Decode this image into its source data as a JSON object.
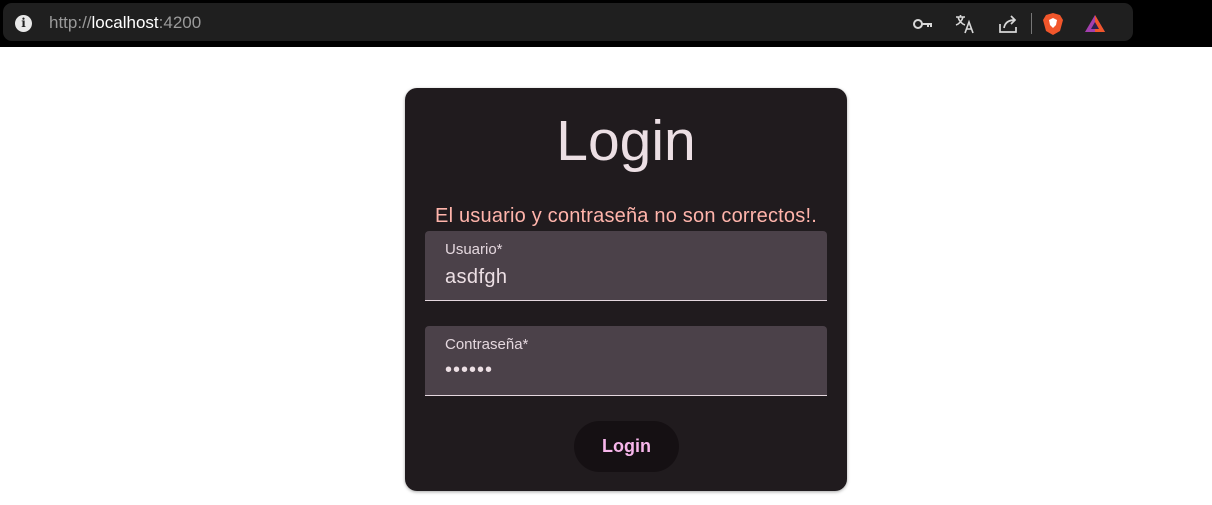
{
  "browser": {
    "url_scheme": "http://",
    "url_host": "localhost",
    "url_port": ":4200",
    "icons": [
      "info-icon",
      "password-key-icon",
      "translate-icon",
      "share-icon",
      "brave-shield-icon",
      "brave-rewards-icon"
    ]
  },
  "login": {
    "title": "Login",
    "error_message": "El usuario y contraseña no son correctos!.",
    "username": {
      "label": "Usuario*",
      "value": "asdfgh"
    },
    "password": {
      "label": "Contraseña*",
      "value": "••••••"
    },
    "submit_label": "Login"
  },
  "colors": {
    "card_background": "#201b1e",
    "field_background": "#4b4149",
    "error_text": "#ffb4ab",
    "button_text": "#f7b6eb",
    "button_background": "#151013"
  }
}
